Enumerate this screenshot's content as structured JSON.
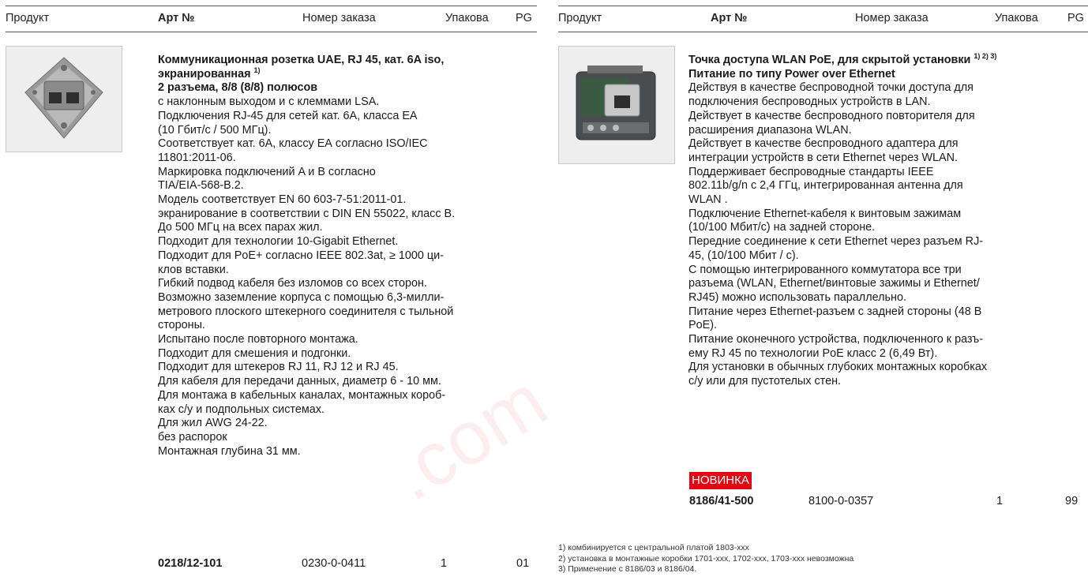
{
  "header": {
    "product": "Продукт",
    "art_no": "Арт №",
    "order_no": "Номер заказа",
    "pack": "Упакова",
    "pg": "PG"
  },
  "left_product": {
    "title_lines": [
      "Коммуникационная розетка UAE, RJ 45, кат. 6A iso,",
      "экранированная ",
      "2 разъема, 8/8 (8/8) полюсов"
    ],
    "title_note_mark": "1)",
    "description_lines": [
      "с наклонным выходом и с клеммами LSA.",
      "Подключения RJ-45 для сетей кат. 6А, класса ЕА",
      "(10 Гбит/с / 500 МГц).",
      "Соответствует кат. 6А, классу ЕА согласно ISO/IEC",
      "11801:2011-06.",
      "Маркировка подключений A и B согласно",
      "TIA/EIA-568-B.2.",
      "Модель соответствует EN 60 603-7-51:2011-01.",
      "экранирование в соответствии с DIN EN 55022, класс B.",
      "До 500 МГц на всех парах жил.",
      "Подходит для технологии 10-Gigabit Ethernet.",
      "Подходит для PoE+ согласно IEEE 802.3at, ≥ 1000 ци-",
      "клов вставки.",
      "Гибкий подвод кабеля без изломов со всех сторон.",
      "Возможно заземление корпуса с помощью 6,3-милли-",
      "метрового плоского штекерного соединителя с тыльной",
      "стороны.",
      "Испытано после повторного монтажа.",
      "Подходит для смешения и подгонки.",
      "Подходит для штекеров RJ 11, RJ 12 и RJ 45.",
      "Для кабеля для передачи данных, диаметр 6 - 10 мм.",
      "Для монтажа в кабельных каналах, монтажных короб-",
      "ках с/у и подпольных системах.",
      "Для жил AWG 24-22.",
      "без распорок",
      "Монтажная глубина 31 мм."
    ],
    "order": {
      "art": "0218/12-101",
      "order_no": "0230-0-0411",
      "pack": "1",
      "pg": "01"
    }
  },
  "right_product": {
    "title_line1": "Точка доступа WLAN PoE, для скрытой установки ",
    "title_note_marks": "1) 2) 3)",
    "title_line2": "Питание по типу Power over Ethernet",
    "description_lines": [
      "Действуя в качестве беспроводной точки доступа для",
      "подключения беспроводных устройств в LAN.",
      "Действует в качестве беспроводного повторителя для",
      "расширения диапазона WLAN.",
      "Действует в качестве беспроводного адаптера для",
      "интеграции устройств в сети Ethernet через WLAN.",
      "Поддерживает беспроводные стандарты IEEE",
      "802.11b/g/n с 2,4 ГГц, интегрированная антенна для",
      "WLAN .",
      "Подключение Ethernet-кабеля к винтовым зажимам",
      "(10/100 Мбит/с) на задней стороне.",
      "Передние соединение к сети Ethernet через разъем RJ-",
      "45, (10/100 Мбит / с).",
      "С помощью интегрированного коммутатора все три",
      "разъема (WLAN, Ethernet/винтовые зажимы и Ethernet/",
      "RJ45) можно использовать параллельно.",
      "Питание через Ethernet-разъем с задней стороны (48 В",
      "PoE).",
      "Питание оконечного устройства, подключенного к разъ-",
      "ему RJ 45 по технологии PoE класс 2 (6,49 Вт).",
      "Для установки в обычных глубоких монтажных коробках",
      "с/у или для пустотелых стен."
    ],
    "badge": "НОВИНКА",
    "order": {
      "art": "8186/41-500",
      "order_no": "8100-0-0357",
      "pack": "1",
      "pg": "99"
    }
  },
  "footnotes": [
    "1)  комбинируется с центральной платой 1803-ххх",
    "2)  установка в монтажные коробки 1701-ххх, 1702-ххх, 1703-ххх невозможна",
    "3)  Применение с 8186/03 и 8186/04."
  ],
  "watermark": ".com",
  "colors": {
    "badge": "#e30613",
    "rule": "#555555",
    "text": "#1a1a1a"
  }
}
